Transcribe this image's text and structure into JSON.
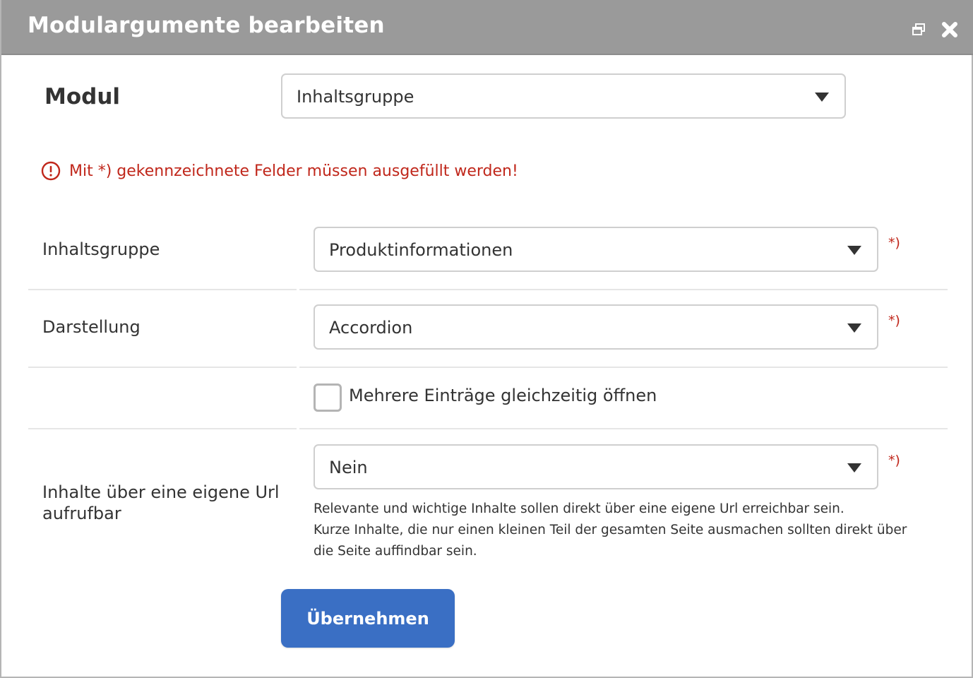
{
  "window": {
    "title": "Modulargumente bearbeiten",
    "titlebar_color": "#9a9a9a",
    "buttons": [
      {
        "name": "restore-icon"
      },
      {
        "name": "close-icon"
      }
    ]
  },
  "modul": {
    "label": "Modul",
    "selected": "Inhaltsgruppe"
  },
  "notice": {
    "icon": "alert-circle-icon",
    "text": "Mit *) gekennzeichnete Felder müssen ausgefüllt werden!",
    "color": "#c0271b"
  },
  "fields": {
    "inhaltsgruppe": {
      "label": "Inhaltsgruppe",
      "selected": "Produktinformationen",
      "required_marker": "*)"
    },
    "darstellung": {
      "label": "Darstellung",
      "selected": "Accordion",
      "required_marker": "*)"
    },
    "multi_open": {
      "label": "Mehrere Einträge gleichzeitig öffnen",
      "checked": false
    },
    "own_url": {
      "label": "Inhalte über eine eigene Url aufrufbar",
      "selected": "Nein",
      "required_marker": "*)",
      "help_lines": [
        "Relevante und wichtige Inhalte sollen direkt über eine eigene Url erreichbar sein.",
        "Kurze Inhalte, die nur einen kleinen Teil der gesamten Seite ausmachen sollten direkt über",
        "die Seite auffindbar sein."
      ]
    }
  },
  "actions": {
    "apply_label": "Übernehmen",
    "apply_color": "#3a6fc4"
  }
}
